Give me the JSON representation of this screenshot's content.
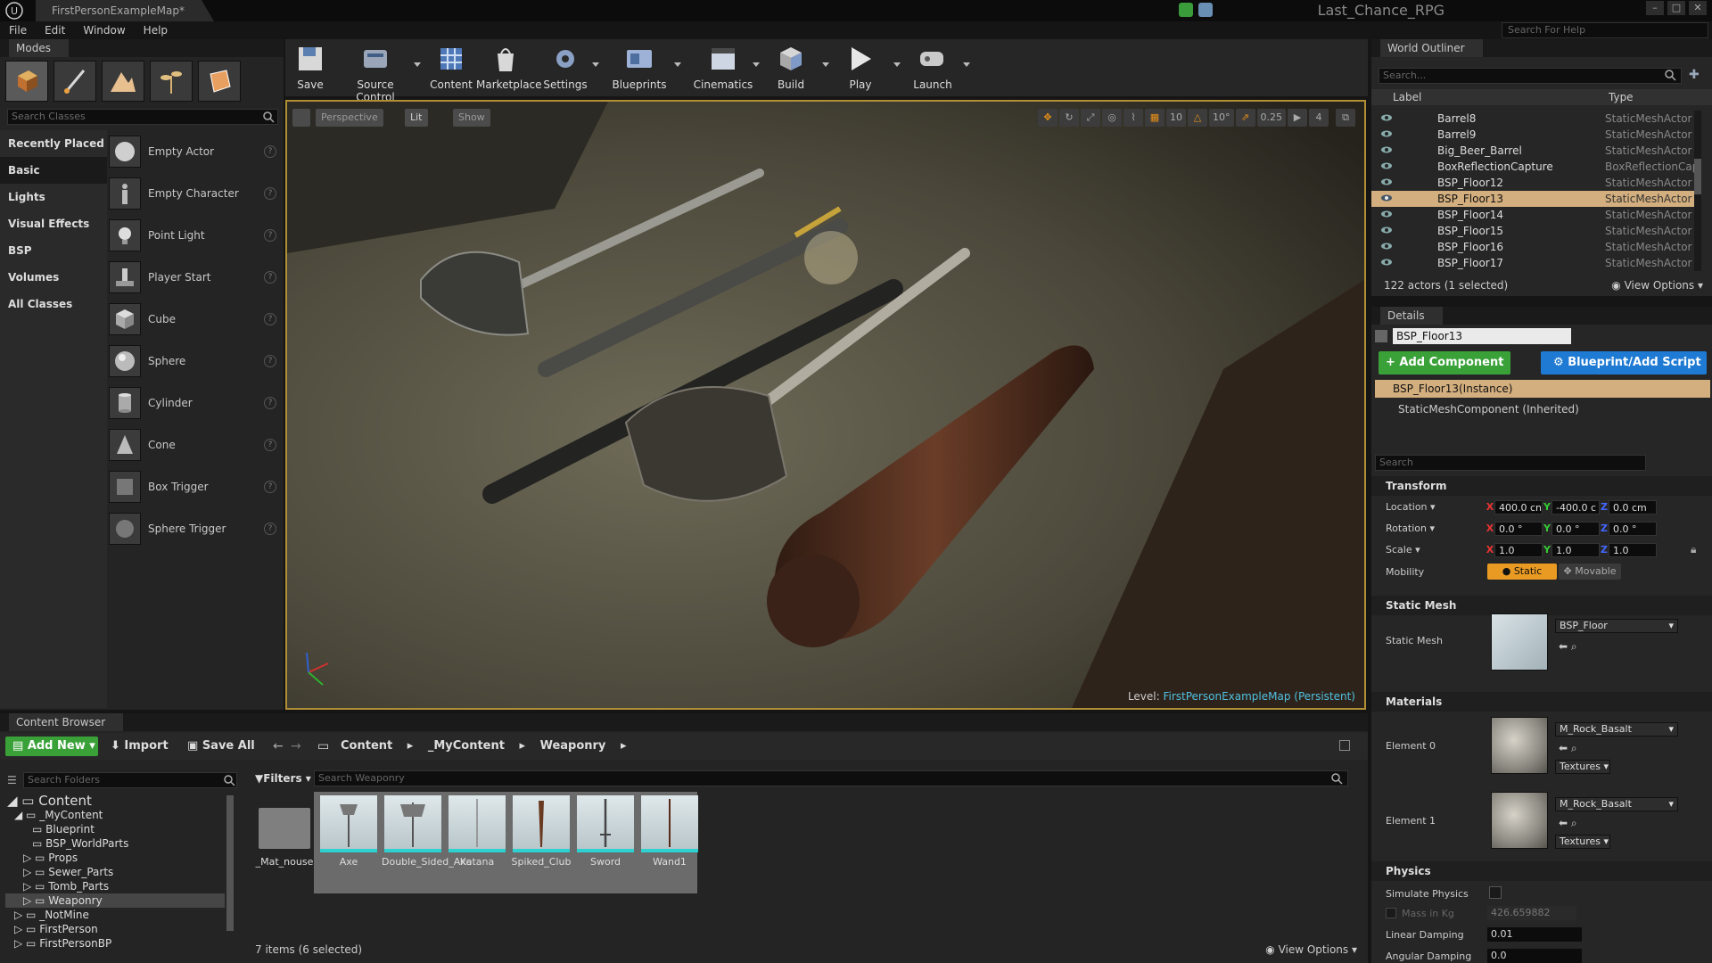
{
  "window": {
    "doc_tab": "FirstPersonExampleMap*",
    "project": "Last_Chance_RPG",
    "help_search_placeholder": "Search For Help"
  },
  "menu": [
    "File",
    "Edit",
    "Window",
    "Help"
  ],
  "modes": {
    "tab_label": "Modes",
    "search_placeholder": "Search Classes",
    "categories": [
      "Recently Placed",
      "Basic",
      "Lights",
      "Visual Effects",
      "BSP",
      "Volumes",
      "All Classes"
    ],
    "items": [
      "Empty Actor",
      "Empty Character",
      "Point Light",
      "Player Start",
      "Cube",
      "Sphere",
      "Cylinder",
      "Cone",
      "Box Trigger",
      "Sphere Trigger"
    ]
  },
  "toolbar": {
    "save": "Save",
    "source_control": "Source Control",
    "content": "Content",
    "marketplace": "Marketplace",
    "settings": "Settings",
    "blueprints": "Blueprints",
    "cinematics": "Cinematics",
    "build": "Build",
    "play": "Play",
    "launch": "Launch"
  },
  "viewport": {
    "perspective": "Perspective",
    "lit": "Lit",
    "show": "Show",
    "grid_snap": "10",
    "rot_snap": "10°",
    "scale_snap": "0.25",
    "cam_speed": "4",
    "level_prefix": "Level:",
    "level_name": "FirstPersonExampleMap (Persistent)"
  },
  "outliner": {
    "tab_label": "World Outliner",
    "search_placeholder": "Search...",
    "col_label": "Label",
    "col_type": "Type",
    "rows": [
      {
        "label": "Barrel8",
        "type": "StaticMeshActor"
      },
      {
        "label": "Barrel9",
        "type": "StaticMeshActor"
      },
      {
        "label": "Big_Beer_Barrel",
        "type": "StaticMeshActor"
      },
      {
        "label": "BoxReflectionCapture",
        "type": "BoxReflectionCap"
      },
      {
        "label": "BSP_Floor12",
        "type": "StaticMeshActor"
      },
      {
        "label": "BSP_Floor13",
        "type": "StaticMeshActor"
      },
      {
        "label": "BSP_Floor14",
        "type": "StaticMeshActor"
      },
      {
        "label": "BSP_Floor15",
        "type": "StaticMeshActor"
      },
      {
        "label": "BSP_Floor16",
        "type": "StaticMeshActor"
      },
      {
        "label": "BSP_Floor17",
        "type": "StaticMeshActor"
      }
    ],
    "count": "122 actors (1 selected)",
    "view_options": "View Options"
  },
  "details": {
    "tab_label": "Details",
    "name": "BSP_Floor13",
    "add_component": "Add Component",
    "blueprint_script": "Blueprint/Add Script",
    "instance": "BSP_Floor13(Instance)",
    "component": "StaticMeshComponent (Inherited)",
    "search_placeholder": "Search",
    "transform_header": "Transform",
    "location_label": "Location",
    "location": [
      "400.0 cn",
      "-400.0 c",
      "0.0 cm"
    ],
    "rotation_label": "Rotation",
    "rotation": [
      "0.0 °",
      "0.0 °",
      "0.0 °"
    ],
    "scale_label": "Scale",
    "scale": [
      "1.0",
      "1.0",
      "1.0"
    ],
    "mobility_label": "Mobility",
    "mobility_static": "Static",
    "mobility_movable": "Movable",
    "static_mesh_header": "Static Mesh",
    "static_mesh_label": "Static Mesh",
    "static_mesh_value": "BSP_Floor",
    "materials_header": "Materials",
    "element0_label": "Element 0",
    "element0_value": "M_Rock_Basalt",
    "element1_label": "Element 1",
    "element1_value": "M_Rock_Basalt",
    "textures": "Textures",
    "physics_header": "Physics",
    "simulate_physics": "Simulate Physics",
    "mass_label": "Mass in Kg",
    "mass_value": "426.659882",
    "linear_damping_label": "Linear Damping",
    "linear_damping": "0.01",
    "angular_damping_label": "Angular Damping",
    "angular_damping": "0.0"
  },
  "content_browser": {
    "tab_label": "Content Browser",
    "add_new": "Add New",
    "import": "Import",
    "save_all": "Save All",
    "breadcrumb": [
      "Content",
      "_MyContent",
      "Weaponry"
    ],
    "folder_search_placeholder": "Search Folders",
    "filters": "Filters",
    "asset_search_placeholder": "Search Weaponry",
    "tree": [
      {
        "name": "Content",
        "depth": 0
      },
      {
        "name": "_MyContent",
        "depth": 1
      },
      {
        "name": "Blueprint",
        "depth": 2
      },
      {
        "name": "BSP_WorldParts",
        "depth": 2
      },
      {
        "name": "Props",
        "depth": 2
      },
      {
        "name": "Sewer_Parts",
        "depth": 2
      },
      {
        "name": "Tomb_Parts",
        "depth": 2
      },
      {
        "name": "Weaponry",
        "depth": 2
      },
      {
        "name": "_NotMine",
        "depth": 1
      },
      {
        "name": "FirstPerson",
        "depth": 1
      },
      {
        "name": "FirstPersonBP",
        "depth": 1
      }
    ],
    "assets": [
      "_Mat_nouse",
      "Axe",
      "Double_Sided_Axe",
      "Katana",
      "Spiked_Club",
      "Sword",
      "Wand1"
    ],
    "status": "7 items (6 selected)",
    "view_options": "View Options"
  }
}
